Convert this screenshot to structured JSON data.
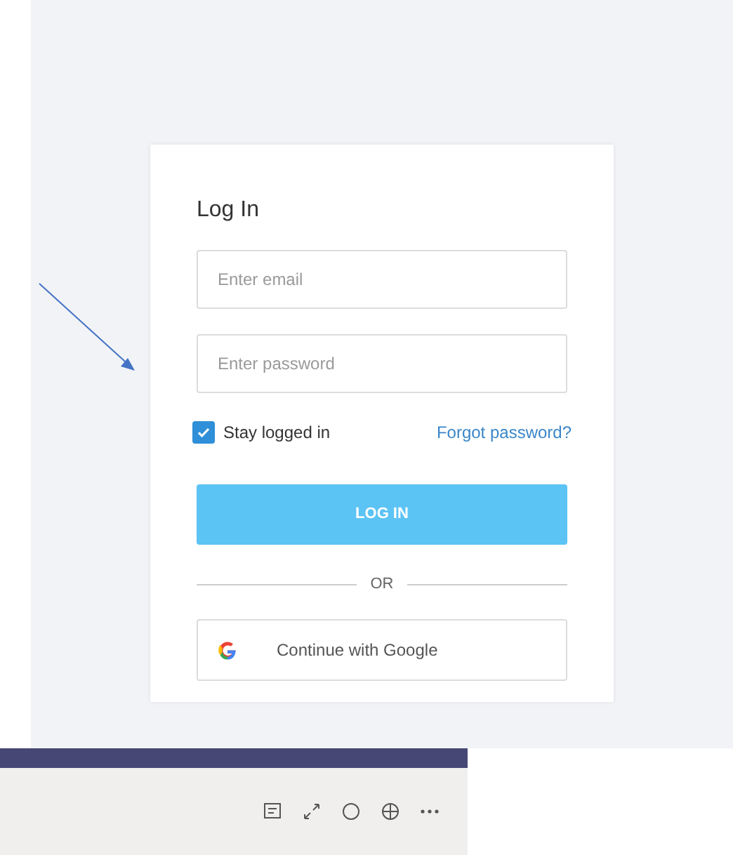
{
  "login": {
    "title": "Log In",
    "email": {
      "placeholder": "Enter email"
    },
    "password": {
      "placeholder": "Enter password"
    },
    "stay_logged_in": {
      "label": "Stay logged in",
      "checked": true
    },
    "forgot_link": "Forgot password?",
    "login_button": "LOG IN",
    "divider": "OR",
    "google_button": "Continue with Google"
  }
}
